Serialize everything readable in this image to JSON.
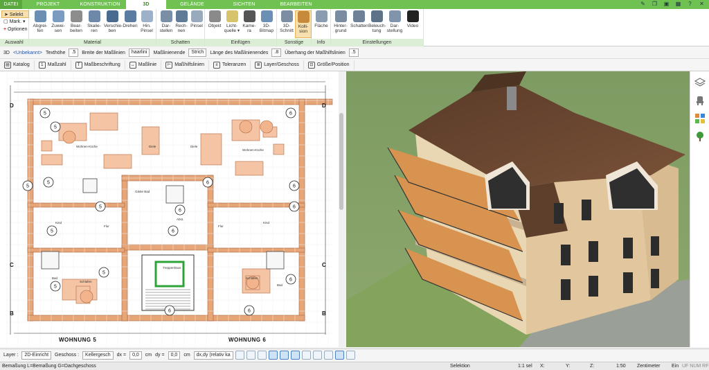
{
  "tabs": [
    "DATEI",
    "PROJEKT",
    "KONSTRUKTION",
    "3D",
    "GELÄNDE",
    "SICHTEN",
    "BEARBEITEN"
  ],
  "selection": {
    "select": "Selekt",
    "mark": "Mark.",
    "options": "Optionen",
    "group": "Auswahl"
  },
  "ribbon_groups": {
    "material": "Material",
    "schatten": "Schatten",
    "einfuegen": "Einfügen",
    "sonstige": "Sonstige",
    "info": "Info",
    "einstellungen": "Einstellungen"
  },
  "material_buttons": [
    {
      "l1": "Abgrei-",
      "l2": "fen"
    },
    {
      "l1": "Zuwei-",
      "l2": "sen"
    },
    {
      "l1": "Bear-",
      "l2": "beiten"
    },
    {
      "l1": "Skalie-",
      "l2": "ren"
    },
    {
      "l1": "Verschie-",
      "l2": "ben"
    },
    {
      "l1": "Drehen",
      "l2": ""
    },
    {
      "l1": "Hin.",
      "l2": "Pinsel"
    }
  ],
  "schatten_buttons": [
    {
      "l1": "Dar-",
      "l2": "stellen"
    },
    {
      "l1": "Rech-",
      "l2": "nen"
    },
    {
      "l1": "Pinsel",
      "l2": ""
    }
  ],
  "einfuegen_buttons": [
    {
      "l1": "Objekt",
      "l2": ""
    },
    {
      "l1": "Licht-",
      "l2": "quelle ▾"
    },
    {
      "l1": "Kame-",
      "l2": "ra"
    },
    {
      "l1": "3D-",
      "l2": "Bitmap"
    }
  ],
  "sonstige_buttons": [
    {
      "l1": "3D-",
      "l2": "Schnitt"
    },
    {
      "l1": "Kolli-",
      "l2": "sion"
    }
  ],
  "info_buttons": [
    {
      "l1": "Fläche",
      "l2": ""
    }
  ],
  "einstellungen_buttons": [
    {
      "l1": "Hinter-",
      "l2": "grund"
    },
    {
      "l1": "Schatten",
      "l2": ""
    },
    {
      "l1": "Beleuch-",
      "l2": "tung"
    },
    {
      "l1": "Dar-",
      "l2": "stellung"
    },
    {
      "l1": "Video",
      "l2": ""
    }
  ],
  "row1": {
    "mode": "3D",
    "layer": "<Unbekannt>",
    "text_height_label": "Texthöhe",
    "text_height_value": ".5",
    "dim_line_width_label": "Breite der Maßlinien",
    "dim_line_width_value": "haarlini",
    "dim_line_end_label": "Maßlinienende",
    "dim_line_end_value": "Strich",
    "dim_line_end_length_label": "Länge des Maßlinienendes",
    "dim_line_end_length_value": ".8",
    "overhang_label": "Überhang der Maßhilfslinien",
    "overhang_value": ".5"
  },
  "row2": [
    "Katalog",
    "Maßzahl",
    "Maßbeschriftung",
    "Maßlinie",
    "Maßhilfslinien",
    "Toleranzen",
    "Layer/Geschoss",
    "Größe/Position"
  ],
  "plan": {
    "unit_left": "WOHNUNG 5",
    "unit_right": "WOHNUNG 6",
    "axis_left": [
      "D",
      "C",
      "B"
    ],
    "axis_right": [
      "D",
      "C",
      "B"
    ],
    "room_numbers": [
      "5",
      "5",
      "5",
      "5",
      "5",
      "5",
      "6",
      "6",
      "6",
      "6",
      "6",
      "6",
      "6",
      "6",
      "5",
      "5",
      "6"
    ],
    "room_labels": [
      "Wohnen-Küche",
      "Diele",
      "Kind",
      "Flur",
      "Bad",
      "Schlafen",
      "Gäste Bad",
      "Abst.",
      "Wohnen-Küche",
      "Diele",
      "Kind",
      "Flur",
      "Schlafen",
      "Bad",
      "Treppenhaus"
    ]
  },
  "row3": {
    "layer_label": "Layer :",
    "layer_value": "2D-Einricht",
    "floor_label": "Geschoss :",
    "floor_value": "Kellergesch",
    "dx_label": "dx =",
    "dx_value": "0,0",
    "dy_label": "dy =",
    "dy_value": "0,0",
    "unit": "cm",
    "rel_value": "dx,dy (relativ ka"
  },
  "status": {
    "left": "Bemaßung L=Bemaßung G=Dachgeschoss",
    "mode": "Selektion",
    "scale_label": "1:1 sel",
    "x": "X:",
    "y": "Y:",
    "z": "Z:",
    "ratio": "1:50",
    "unit": "Zentimeter",
    "ein": "Ein",
    "flags": "UF NUM RF"
  }
}
